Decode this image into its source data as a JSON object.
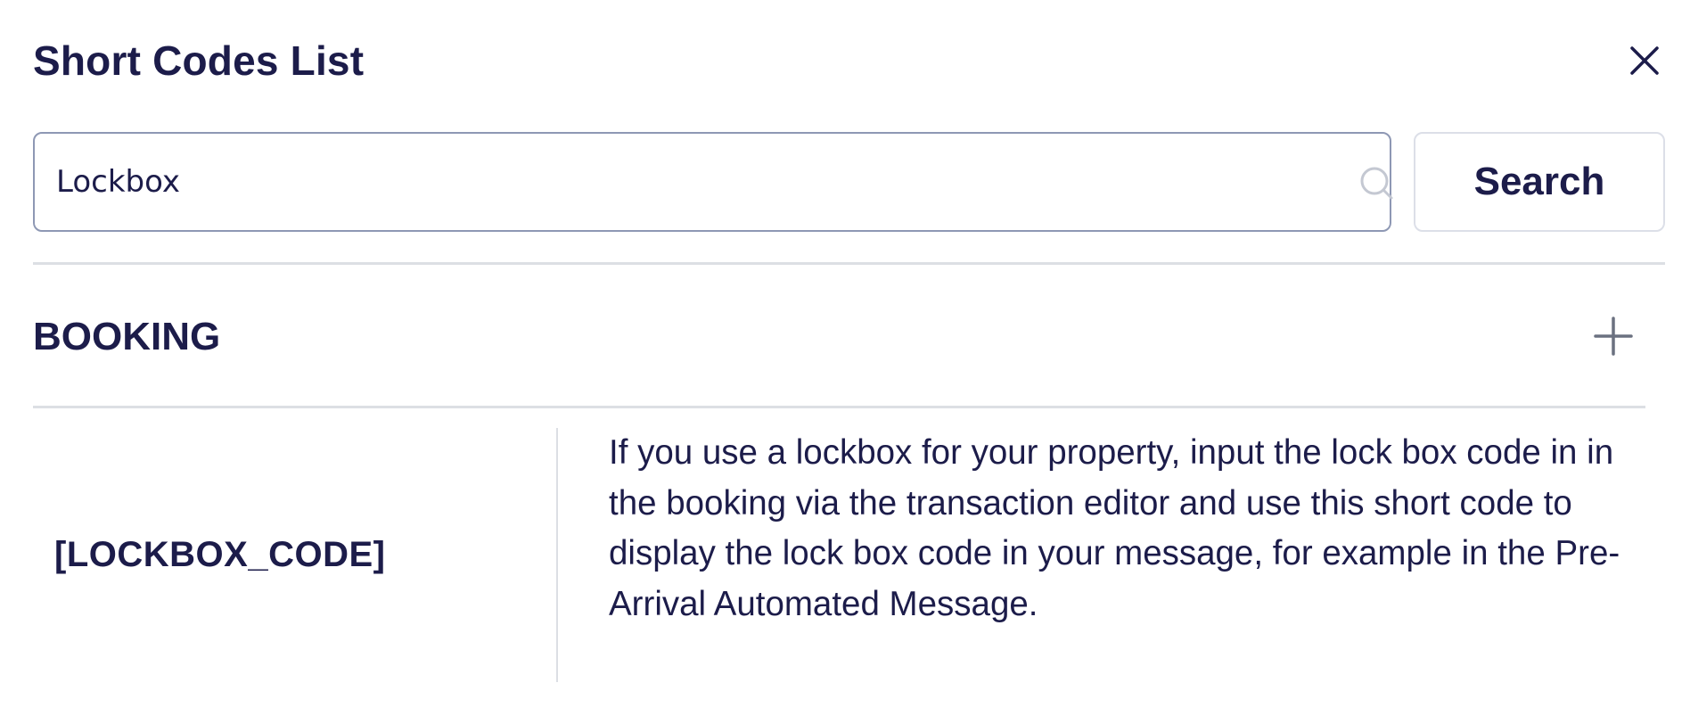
{
  "dialog": {
    "title": "Short Codes List",
    "close_icon": "close-icon"
  },
  "search": {
    "value": "Lockbox",
    "icon": "search-icon",
    "button_label": "Search"
  },
  "section": {
    "title": "BOOKING",
    "toggle_icon": "plus-icon"
  },
  "rows": [
    {
      "code": "[LOCKBOX_CODE]",
      "description": "If you use a lockbox for your property, input the lock box code in in the booking via the transaction editor and use this short code to display the lock box code in your message, for example in the Pre-Arrival Automated Message."
    }
  ],
  "colors": {
    "text": "#1c1c4a",
    "border": "#8e98b4",
    "divider": "#dcdfe4"
  }
}
